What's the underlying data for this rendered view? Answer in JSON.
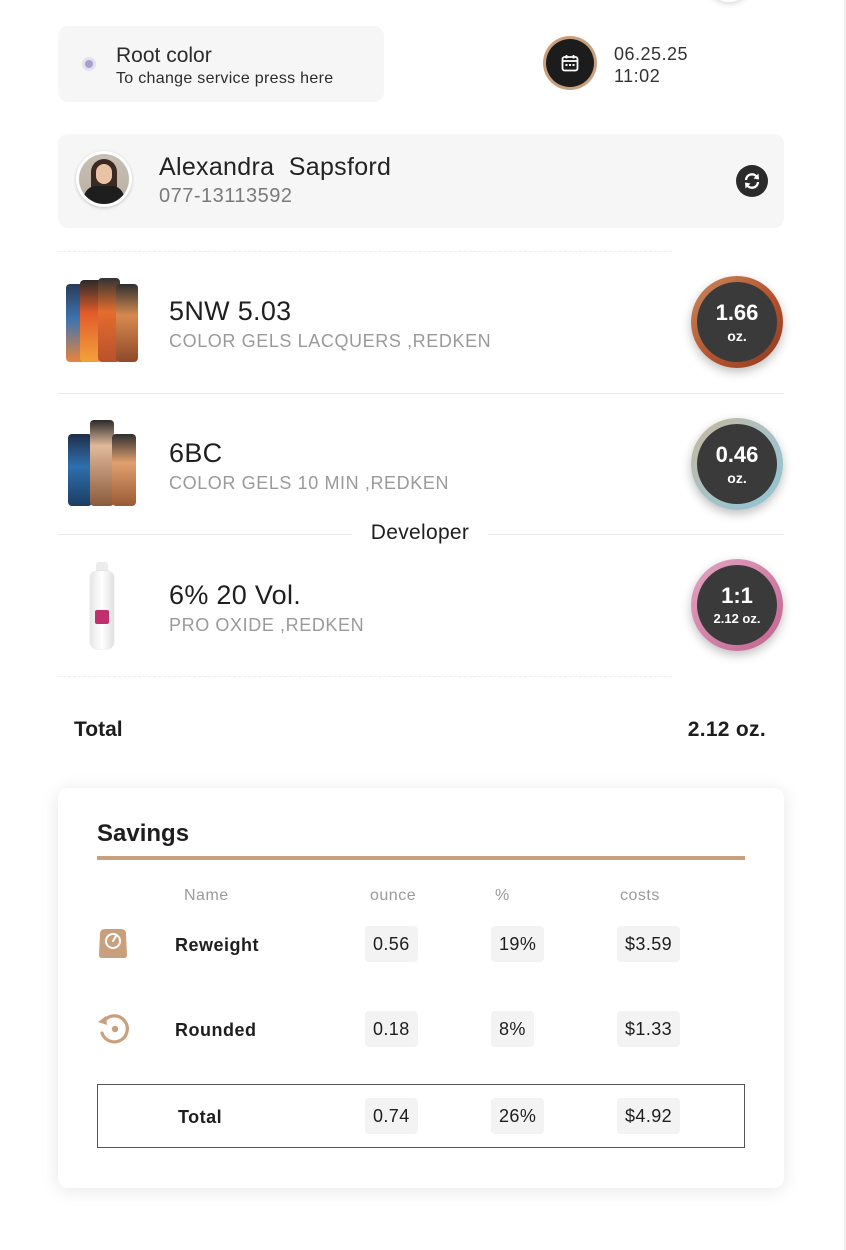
{
  "service": {
    "title": "Root color",
    "subtitle": "To change service press here"
  },
  "appointment": {
    "date": "06.25.25",
    "time": "11:02"
  },
  "client": {
    "name": "Alexandra  Sapsford",
    "phone": "077-13113592"
  },
  "products": [
    {
      "name": "5NW 5.03",
      "brand": "COLOR GELS LACQUERS ,REDKEN",
      "amount": "1.66",
      "unit": "oz.",
      "ring_colors": [
        "#b4532e",
        "#c98a5e"
      ]
    },
    {
      "name": "6BC",
      "brand": "COLOR GELS 10 MIN ,REDKEN",
      "amount": "0.46",
      "unit": "oz.",
      "ring_colors": [
        "#c8b89a",
        "#8fc3d6"
      ]
    },
    {
      "name": "6% 20 Vol.",
      "brand": "PRO OXIDE ,REDKEN",
      "amount": "1:1",
      "unit": "2.12 oz.",
      "ring_colors": [
        "#d17fa8",
        "#e4a6c3"
      ]
    }
  ],
  "developer_label": "Developer",
  "total": {
    "label": "Total",
    "value": "2.12 oz."
  },
  "savings": {
    "title": "Savings",
    "accent_color": "#c9a07e",
    "headers": {
      "name": "Name",
      "ounce": "ounce",
      "percent": "%",
      "costs": "costs"
    },
    "rows": [
      {
        "icon": "scale-icon",
        "name": "Reweight",
        "ounce": "0.56",
        "percent": "19%",
        "cost": "$3.59"
      },
      {
        "icon": "rounding-icon",
        "name": "Rounded",
        "ounce": "0.18",
        "percent": "8%",
        "cost": "$1.33"
      }
    ],
    "total": {
      "name": "Total",
      "ounce": "0.74",
      "percent": "26%",
      "cost": "$4.92"
    }
  }
}
